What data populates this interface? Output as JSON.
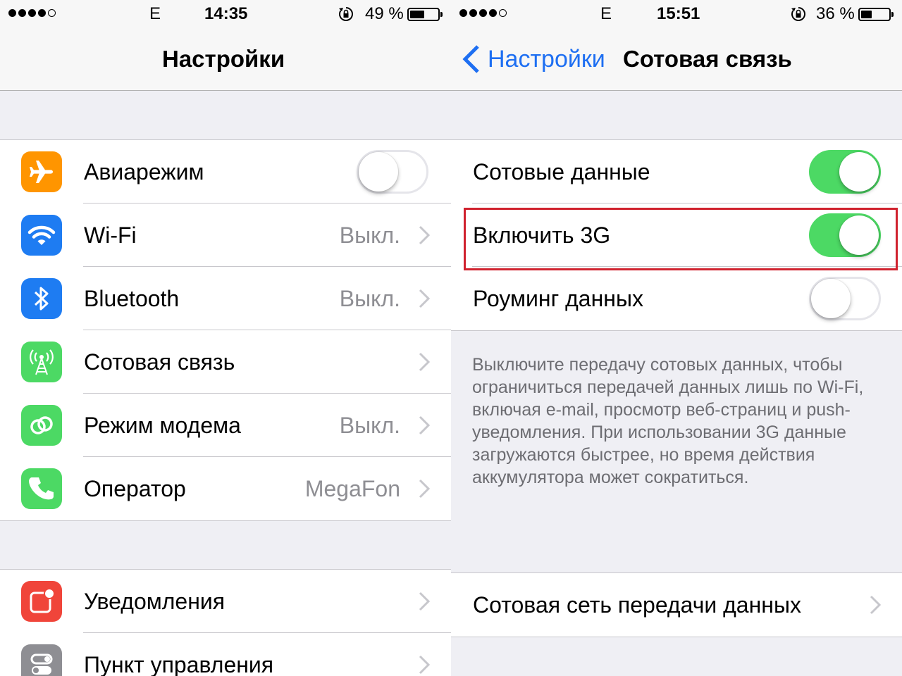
{
  "left": {
    "status": {
      "carrier_dots": 5,
      "carrier_dots_on": 4,
      "network": "E",
      "time": "14:35",
      "battery_text": "49 %",
      "battery_level": 0.49
    },
    "nav": {
      "title": "Настройки"
    },
    "group1": [
      {
        "label": "Авиарежим",
        "icon": "airplane-icon",
        "icon_color": "#ff9500",
        "control": "toggle",
        "toggle_on": false
      },
      {
        "label": "Wi-Fi",
        "icon": "wifi-icon",
        "icon_color": "#1e7cf2",
        "value": "Выкл.",
        "control": "chevron"
      },
      {
        "label": "Bluetooth",
        "icon": "bluetooth-icon",
        "icon_color": "#1e7cf2",
        "value": "Выкл.",
        "control": "chevron"
      },
      {
        "label": "Сотовая связь",
        "icon": "cellular-antenna-icon",
        "icon_color": "#4cd964",
        "value": "",
        "control": "chevron"
      },
      {
        "label": "Режим модема",
        "icon": "hotspot-chain-icon",
        "icon_color": "#4cd964",
        "value": "Выкл.",
        "control": "chevron"
      },
      {
        "label": "Оператор",
        "icon": "phone-handset-icon",
        "icon_color": "#4cd964",
        "value": "MegaFon",
        "control": "chevron"
      }
    ],
    "group2": [
      {
        "label": "Уведомления",
        "icon": "notifications-icon",
        "icon_color": "#f0453a",
        "value": "",
        "control": "chevron"
      },
      {
        "label": "Пункт управления",
        "icon": "control-center-icon",
        "icon_color": "#8e8e93",
        "value": "",
        "control": "chevron"
      }
    ]
  },
  "right": {
    "status": {
      "carrier_dots": 5,
      "carrier_dots_on": 4,
      "network": "E",
      "time": "15:51",
      "battery_text": "36 %",
      "battery_level": 0.36
    },
    "nav": {
      "back_label": "Настройки",
      "title": "Сотовая связь"
    },
    "group1": [
      {
        "label": "Сотовые данные",
        "control": "toggle",
        "toggle_on": true
      },
      {
        "label": "Включить 3G",
        "control": "toggle",
        "toggle_on": true,
        "highlighted": true,
        "highlight_color": "#d0222e"
      },
      {
        "label": "Роуминг данных",
        "control": "toggle",
        "toggle_on": false
      }
    ],
    "footer_note": "Выключите передачу сотовых данных, чтобы ограничиться передачей данных лишь по Wi-Fi, включая e-mail, просмотр веб-страниц и push-уведомления. При использовании 3G данные загружаются быстрее, но время действия аккумулятора может сократиться.",
    "group2": [
      {
        "label": "Сотовая сеть передачи данных",
        "control": "chevron"
      }
    ]
  }
}
